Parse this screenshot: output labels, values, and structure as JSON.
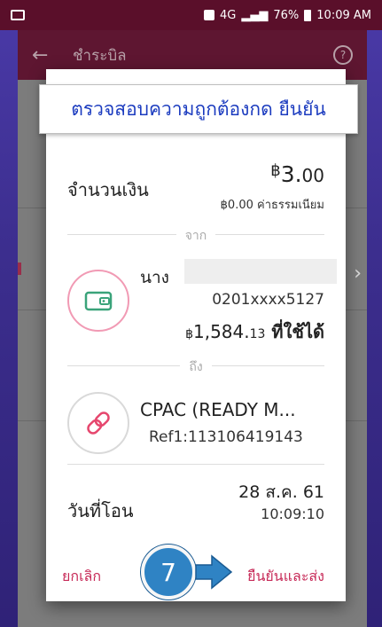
{
  "status_bar": {
    "battery": "76%",
    "time": "10:09 AM",
    "network": "4G"
  },
  "app": {
    "title": "ชำระบิล",
    "help": "?"
  },
  "callout": {
    "text": "ตรวจสอบความถูกต้องกด ยืนยัน"
  },
  "dialog": {
    "amount_label": "จำนวนเงิน",
    "amount_currency": "฿",
    "amount_main": "3.",
    "amount_cents": "00",
    "fee": "฿0.00 ค่าธรรมเนียม",
    "from_label": "จาก",
    "account_name": "นาง",
    "account_number": "0201xxxx5127",
    "balance_currency": "฿",
    "balance_main": "1,584.",
    "balance_cents": "13",
    "balance_suffix": " ที่ใช้ได้",
    "to_label": "ถึง",
    "biller_name": "CPAC (READY M...",
    "biller_ref": "Ref1:113106419143",
    "date_label": "วันที่โอน",
    "date_value": "28 ส.ค. 61",
    "time_value": "10:09:10",
    "cancel_label": "ยกเลิก",
    "confirm_label": "ยืนยันและส่ง"
  },
  "step": {
    "number": "7"
  },
  "colors": {
    "accent": "#c72a58",
    "header": "#5e1631",
    "callout_text": "#1b3bbf",
    "step": "#2f83c4"
  }
}
